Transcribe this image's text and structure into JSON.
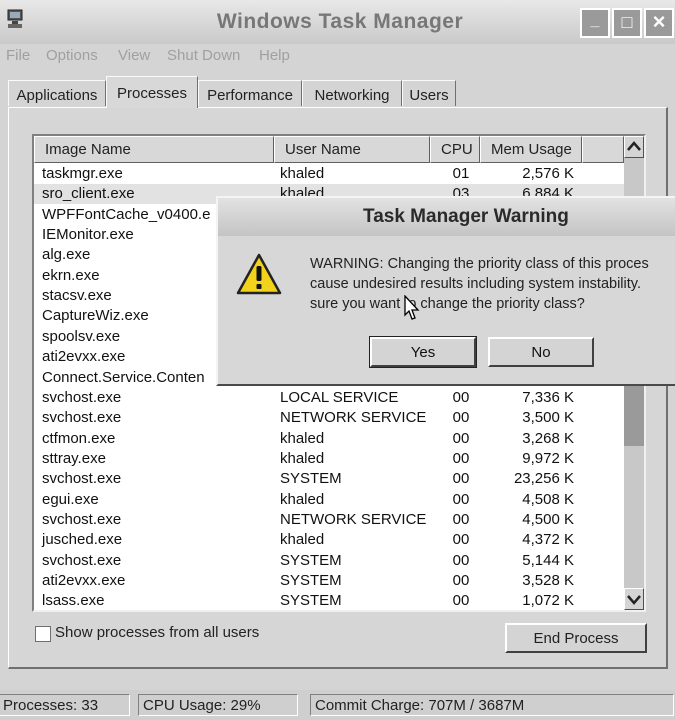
{
  "window": {
    "title": "Windows Task Manager"
  },
  "titlebar_buttons": {
    "minimize": "_",
    "maximize": "□",
    "close": "×"
  },
  "menu": [
    "File",
    "Options",
    "View",
    "Shut Down",
    "Help"
  ],
  "tabs": [
    "Applications",
    "Processes",
    "Performance",
    "Networking",
    "Users"
  ],
  "active_tab": "Processes",
  "columns": [
    "Image Name",
    "User Name",
    "CPU",
    "Mem Usage"
  ],
  "processes": [
    {
      "name": "taskmgr.exe",
      "user": "khaled",
      "cpu": "01",
      "mem": "2,576 K"
    },
    {
      "name": "sro_client.exe",
      "user": "khaled",
      "cpu": "03",
      "mem": "6,884 K"
    },
    {
      "name": "WPFFontCache_v0400.e",
      "user": "",
      "cpu": "",
      "mem": ""
    },
    {
      "name": "IEMonitor.exe",
      "user": "",
      "cpu": "",
      "mem": ""
    },
    {
      "name": "alg.exe",
      "user": "",
      "cpu": "",
      "mem": ""
    },
    {
      "name": "ekrn.exe",
      "user": "",
      "cpu": "",
      "mem": ""
    },
    {
      "name": "stacsv.exe",
      "user": "",
      "cpu": "",
      "mem": ""
    },
    {
      "name": "CaptureWiz.exe",
      "user": "",
      "cpu": "",
      "mem": ""
    },
    {
      "name": "spoolsv.exe",
      "user": "",
      "cpu": "",
      "mem": ""
    },
    {
      "name": "ati2evxx.exe",
      "user": "",
      "cpu": "",
      "mem": ""
    },
    {
      "name": "Connect.Service.Conten",
      "user": "",
      "cpu": "",
      "mem": ""
    },
    {
      "name": "svchost.exe",
      "user": "LOCAL SERVICE",
      "cpu": "00",
      "mem": "7,336 K"
    },
    {
      "name": "svchost.exe",
      "user": "NETWORK SERVICE",
      "cpu": "00",
      "mem": "3,500 K"
    },
    {
      "name": "ctfmon.exe",
      "user": "khaled",
      "cpu": "00",
      "mem": "3,268 K"
    },
    {
      "name": "sttray.exe",
      "user": "khaled",
      "cpu": "00",
      "mem": "9,972 K"
    },
    {
      "name": "svchost.exe",
      "user": "SYSTEM",
      "cpu": "00",
      "mem": "23,256 K"
    },
    {
      "name": "egui.exe",
      "user": "khaled",
      "cpu": "00",
      "mem": "4,508 K"
    },
    {
      "name": "svchost.exe",
      "user": "NETWORK SERVICE",
      "cpu": "00",
      "mem": "4,500 K"
    },
    {
      "name": "jusched.exe",
      "user": "khaled",
      "cpu": "00",
      "mem": "4,372 K"
    },
    {
      "name": "svchost.exe",
      "user": "SYSTEM",
      "cpu": "00",
      "mem": "5,144 K"
    },
    {
      "name": "ati2evxx.exe",
      "user": "SYSTEM",
      "cpu": "00",
      "mem": "3,528 K"
    },
    {
      "name": "lsass.exe",
      "user": "SYSTEM",
      "cpu": "00",
      "mem": "1,072 K"
    }
  ],
  "selected_row": 1,
  "show_all_users_label": "Show processes from all users",
  "show_all_users_checked": false,
  "end_process_label": "End Process",
  "status": {
    "processes": "Processes: 33",
    "cpu": "CPU Usage: 29%",
    "commit": "Commit Charge: 707M / 3687M"
  },
  "dialog": {
    "title": "Task Manager Warning",
    "message_lines": [
      "WARNING: Changing the priority class of this proces",
      "cause undesired results including system instability.",
      "sure you want to change the priority class?"
    ],
    "yes_label": "Yes",
    "no_label": "No",
    "icon": "warning-icon"
  }
}
